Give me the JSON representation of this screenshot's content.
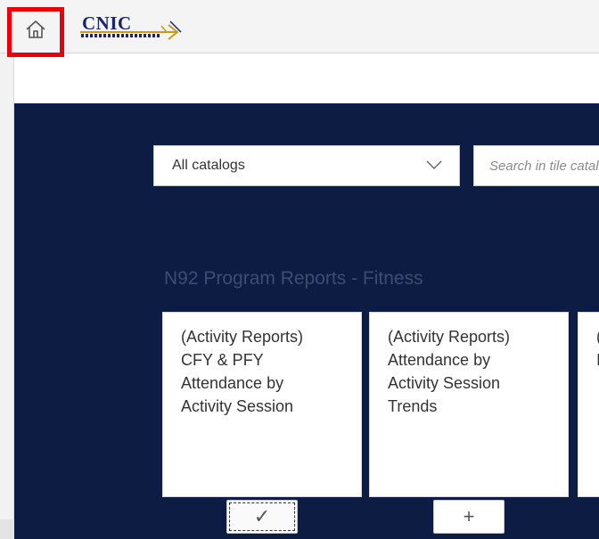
{
  "shell": {
    "home_icon": "home-icon",
    "logo_text": "CNIC"
  },
  "catalog": {
    "selected": "All catalogs",
    "dropdown_icon": "chevron-down-icon"
  },
  "search": {
    "placeholder": "Search in tile catalog"
  },
  "group": {
    "title": "N92 Program Reports - Fitness"
  },
  "tiles": [
    {
      "title": "(Activity Reports)\nCFY & PFY\nAttendance by\nActivity Session",
      "action_icon": "check-icon",
      "action_label": "✓"
    },
    {
      "title": "(Activity Reports)\nAttendance by\nActivity Session\nTrends",
      "action_icon": "plus-icon",
      "action_label": "+"
    },
    {
      "title": "(\nI"
    }
  ],
  "colors": {
    "panel": "#0d1c43",
    "highlight": "#e8000b",
    "group_title": "#3d4d70"
  }
}
